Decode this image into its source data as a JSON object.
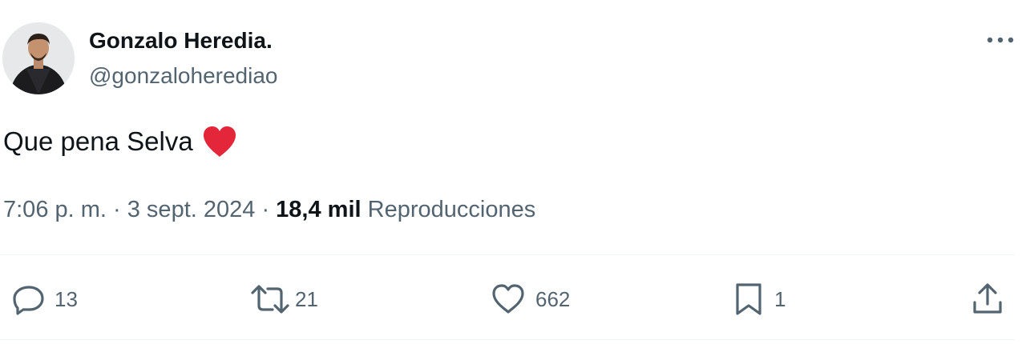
{
  "author": {
    "display_name": "Gonzalo Heredia.",
    "handle": "@gonzaloherediao",
    "avatar_icon": "profile-photo"
  },
  "tweet": {
    "text": "Que pena Selva",
    "emoji": "red-heart-icon"
  },
  "meta": {
    "time": "7:06 p. m.",
    "separator": "·",
    "date": "3 sept. 2024",
    "views_count": "18,4 mil",
    "views_label": "Reproducciones"
  },
  "actions": {
    "replies": "13",
    "reposts": "21",
    "likes": "662",
    "bookmarks": "1"
  },
  "colors": {
    "text_primary": "#0f1419",
    "text_secondary": "#536471",
    "heart": "#f91880",
    "divider": "#eff3f4"
  }
}
